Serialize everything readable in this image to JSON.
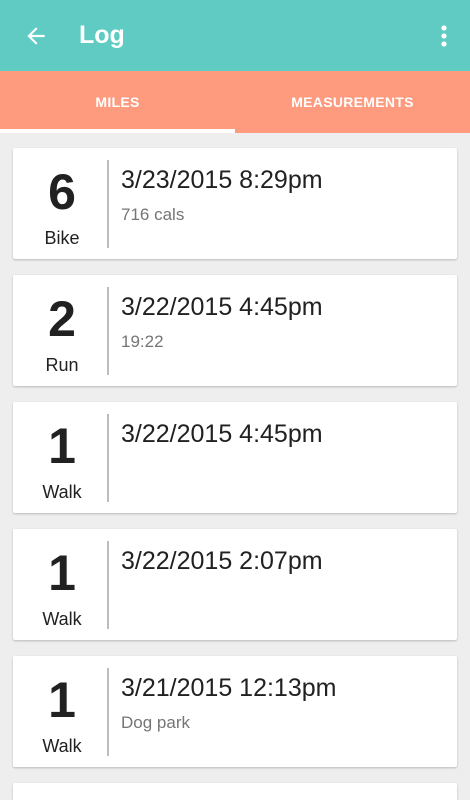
{
  "appbar": {
    "title": "Log",
    "back_icon": "arrow-left-icon",
    "menu_icon": "more-vert-icon",
    "color": "#5fcbc3"
  },
  "tabs": {
    "color": "#fe9a7e",
    "items": [
      {
        "label": "MILES",
        "selected": true
      },
      {
        "label": "MEASUREMENTS",
        "selected": false
      }
    ]
  },
  "entries": [
    {
      "amount": "6",
      "activity": "Bike",
      "datetime": "3/23/2015 8:29pm",
      "note": "716 cals"
    },
    {
      "amount": "2",
      "activity": "Run",
      "datetime": "3/22/2015 4:45pm",
      "note": "19:22"
    },
    {
      "amount": "1",
      "activity": "Walk",
      "datetime": "3/22/2015 4:45pm",
      "note": ""
    },
    {
      "amount": "1",
      "activity": "Walk",
      "datetime": "3/22/2015 2:07pm",
      "note": ""
    },
    {
      "amount": "1",
      "activity": "Walk",
      "datetime": "3/21/2015 12:13pm",
      "note": "Dog park"
    }
  ]
}
